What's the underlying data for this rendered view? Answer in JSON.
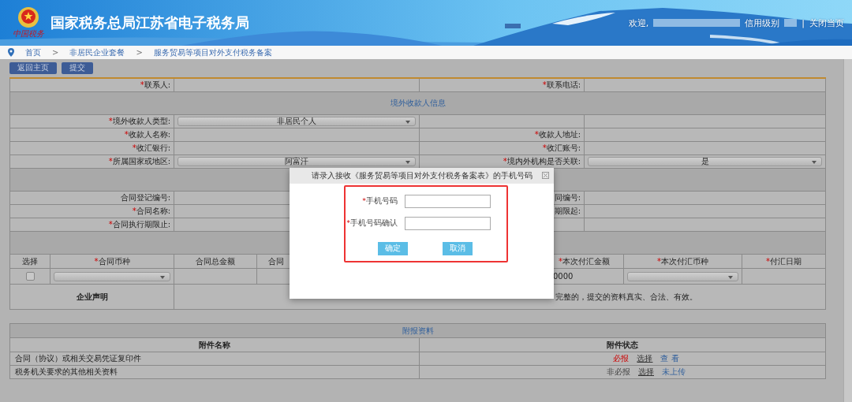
{
  "header": {
    "emblem_caption": "中国税务",
    "title": "国家税务总局江苏省电子税务局",
    "welcome": "欢迎,",
    "credit_label": "信用级别",
    "separator": "|",
    "close_link": "关闭当页"
  },
  "breadcrumb": [
    {
      "kind": "link",
      "text": "首页"
    },
    {
      "kind": "sep",
      "text": ">"
    },
    {
      "kind": "link",
      "text": "非居民企业套餐"
    },
    {
      "kind": "sep",
      "text": ">"
    },
    {
      "kind": "link",
      "text": "服务贸易等项目对外支付税务备案"
    }
  ],
  "toolbar": [
    "返回主页",
    "提交"
  ],
  "form_rows": [
    {
      "kind": "fields",
      "cells": [
        {
          "mark": "*",
          "label": "联系人:"
        },
        {
          "mark": "*",
          "label": "联系电话:"
        }
      ]
    },
    {
      "kind": "section",
      "title": "境外收款人信息"
    },
    {
      "kind": "fields",
      "cells": [
        {
          "mark": "*",
          "label": "境外收款人类型:",
          "select": "非居民个人"
        }
      ]
    },
    {
      "kind": "fields",
      "cells": [
        {
          "mark": "*",
          "label": "收款人名称:"
        },
        {
          "mark": "*",
          "label": "收款人地址:"
        }
      ]
    },
    {
      "kind": "fields",
      "cells": [
        {
          "mark": "*",
          "label": "收汇银行:"
        },
        {
          "mark": "*",
          "label": "收汇账号:"
        }
      ]
    },
    {
      "kind": "fields",
      "cells": [
        {
          "mark": "*",
          "label": "所属国家或地区:",
          "select": "阿富汗"
        },
        {
          "mark": "*",
          "label": "境内外机构是否关联:",
          "select": "是"
        }
      ]
    },
    {
      "kind": "section"
    },
    {
      "kind": "fields",
      "cells": [
        {
          "label": "合同登记编号:"
        },
        {
          "label": "同编号:"
        }
      ]
    },
    {
      "kind": "fields",
      "cells": [
        {
          "mark": "*",
          "label": "合同名称:"
        },
        {
          "label": "期限起:"
        }
      ]
    },
    {
      "kind": "fields",
      "cells": [
        {
          "mark": "*",
          "label": "合同执行期限止:"
        }
      ]
    },
    {
      "kind": "section"
    }
  ],
  "currency_table": {
    "columns": [
      {
        "label": "选择"
      },
      {
        "mark": "*",
        "label": "合同币种"
      },
      {
        "label": "合同总金额"
      },
      {
        "label": "合同"
      },
      {
        "mark": "*",
        "label": "本次付汇金额"
      },
      {
        "mark": "*",
        "label": "本次付汇币种"
      },
      {
        "mark": "*",
        "label": "付汇日期"
      }
    ],
    "rows": [
      {
        "checked": false,
        "current_amount": "0000"
      }
    ]
  },
  "declaration": {
    "label": "企业声明",
    "text": "完整的，提交的资料真实、合法、有效。"
  },
  "attachments": {
    "title": "附报资料",
    "columns": [
      "附件名称",
      "附件状态"
    ],
    "rows": [
      {
        "name": "合同（协议）或相关交易凭证复印件",
        "requirement": "必报",
        "mandatory": true,
        "select": "选择",
        "status": "查 看"
      },
      {
        "name": "税务机关要求的其他相关资料",
        "requirement": "非必报",
        "mandatory": false,
        "select": "选择",
        "status": "未上传"
      }
    ]
  },
  "modal": {
    "title": "请录入接收《服务贸易等项目对外支付税务备案表》的手机号码",
    "fields": [
      {
        "mark": "*",
        "label": "手机号码"
      },
      {
        "mark": "*",
        "label": "手机号码确认"
      }
    ],
    "buttons": [
      "确定",
      "取消"
    ]
  }
}
